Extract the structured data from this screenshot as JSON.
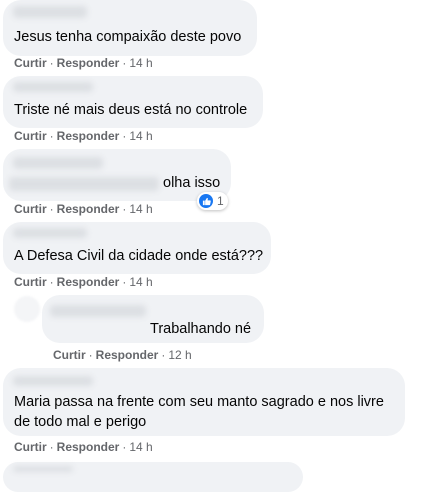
{
  "comments": [
    {
      "text": "Jesus tenha compaixão deste povo",
      "like": "Curtir",
      "reply": "Responder",
      "time": "14 h"
    },
    {
      "text": "Triste né mais deus está no controle",
      "like": "Curtir",
      "reply": "Responder",
      "time": "14 h"
    },
    {
      "text": "olha isso",
      "like": "Curtir",
      "reply": "Responder",
      "time": "14 h",
      "reactions": "1"
    },
    {
      "text": "A Defesa Civil da cidade onde está???",
      "like": "Curtir",
      "reply": "Responder",
      "time": "14 h"
    },
    {
      "text": "Trabalhando né",
      "like": "Curtir",
      "reply": "Responder",
      "time": "12 h"
    },
    {
      "text": "Maria passa na frente com seu manto sagrado e nos livre de todo mal e perigo",
      "like": "Curtir",
      "reply": "Responder",
      "time": "14 h"
    }
  ],
  "colors": {
    "bubble": "#f0f2f5",
    "meta": "#65676b",
    "like_badge": "#1877f2"
  }
}
